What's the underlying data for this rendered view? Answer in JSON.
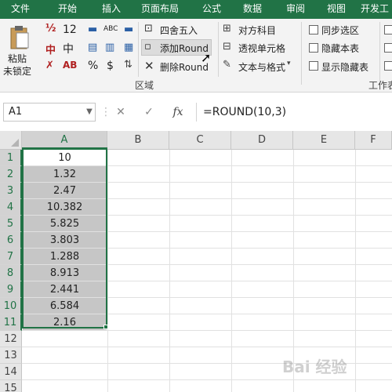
{
  "menu": {
    "file": "文件",
    "home": "开始",
    "insert": "插入",
    "page_layout": "页面布局",
    "formulas": "公式",
    "data": "数据",
    "review": "审阅",
    "view": "视图",
    "developer": "开发工"
  },
  "ribbon": {
    "paste_label_line1": "粘贴",
    "paste_label_line2": "未锁定",
    "icons_row1_a": "12",
    "icons_row2_b": "中",
    "icons_row3_a": "%",
    "icons_row3_b": "$",
    "abc_label": "ABC",
    "round_label": "四舍五入",
    "add_round_label": "添加Round",
    "delete_round_label": "删除Round",
    "align_label": "对方科目",
    "pivot_cell_label": "透视单元格",
    "text_format_label": "文本与格式",
    "sync_label": "同步选区",
    "hide_sheet_label": "隐藏本表",
    "show_hidden_label": "显示隐藏表",
    "group_area_label": "区域",
    "group_sheet_label": "工作表"
  },
  "formula_bar": {
    "name_box": "A1",
    "cancel_icon": "✕",
    "enter_icon": "✓",
    "fx_label": "fx",
    "formula": "=ROUND(10,3)"
  },
  "columns": [
    "A",
    "B",
    "C",
    "D",
    "E",
    "F"
  ],
  "rows": [
    "1",
    "2",
    "3",
    "4",
    "5",
    "6",
    "7",
    "8",
    "9",
    "10",
    "11",
    "12",
    "13",
    "14",
    "15"
  ],
  "cells_A": [
    "10",
    "1.32",
    "2.47",
    "10.382",
    "5.825",
    "3.803",
    "1.288",
    "8.913",
    "2.441",
    "6.584",
    "2.16"
  ],
  "watermark": "Bai 经验",
  "colors": {
    "accent": "#217346",
    "selection_fill": "#c6c6c6"
  }
}
